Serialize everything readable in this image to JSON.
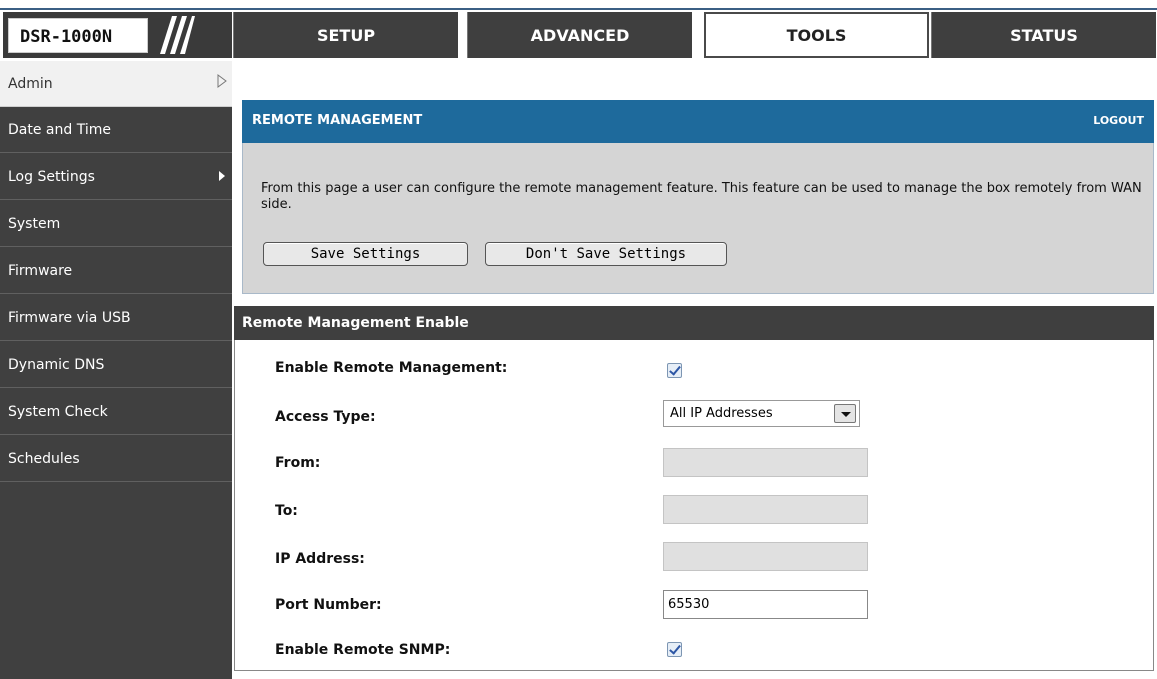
{
  "app": {
    "model": "DSR-1000N"
  },
  "nav": {
    "tabs": [
      {
        "label": "SETUP",
        "active": false
      },
      {
        "label": "ADVANCED",
        "active": false
      },
      {
        "label": "TOOLS",
        "active": true
      },
      {
        "label": "STATUS",
        "active": false
      }
    ]
  },
  "sidebar": {
    "items": [
      {
        "label": "Admin",
        "active": true
      },
      {
        "label": "Date and Time"
      },
      {
        "label": "Log Settings"
      },
      {
        "label": "System"
      },
      {
        "label": "Firmware"
      },
      {
        "label": "Firmware via USB"
      },
      {
        "label": "Dynamic DNS"
      },
      {
        "label": "System Check"
      },
      {
        "label": "Schedules"
      }
    ]
  },
  "panel": {
    "title": "REMOTE MANAGEMENT",
    "logout": "LOGOUT",
    "description": "From this page a user can configure the remote management feature. This feature can be used to manage the box remotely from WAN side.",
    "save_label": "Save Settings",
    "dont_save_label": "Don't Save Settings"
  },
  "form": {
    "section_title": "Remote Management Enable",
    "enable_remote_label": "Enable Remote Management:",
    "enable_remote_checked": true,
    "access_type_label": "Access Type:",
    "access_type_value": "All IP Addresses",
    "from_label": "From:",
    "from_value": "",
    "to_label": "To:",
    "to_value": "",
    "ip_label": "IP Address:",
    "ip_value": "",
    "port_label": "Port Number:",
    "port_value": "65530",
    "snmp_label": "Enable Remote SNMP:",
    "snmp_checked": true
  },
  "colors": {
    "panel_header": "#1e6a9c",
    "nav_dark": "#3f3f3f",
    "panel_body": "#d5d5d5"
  }
}
